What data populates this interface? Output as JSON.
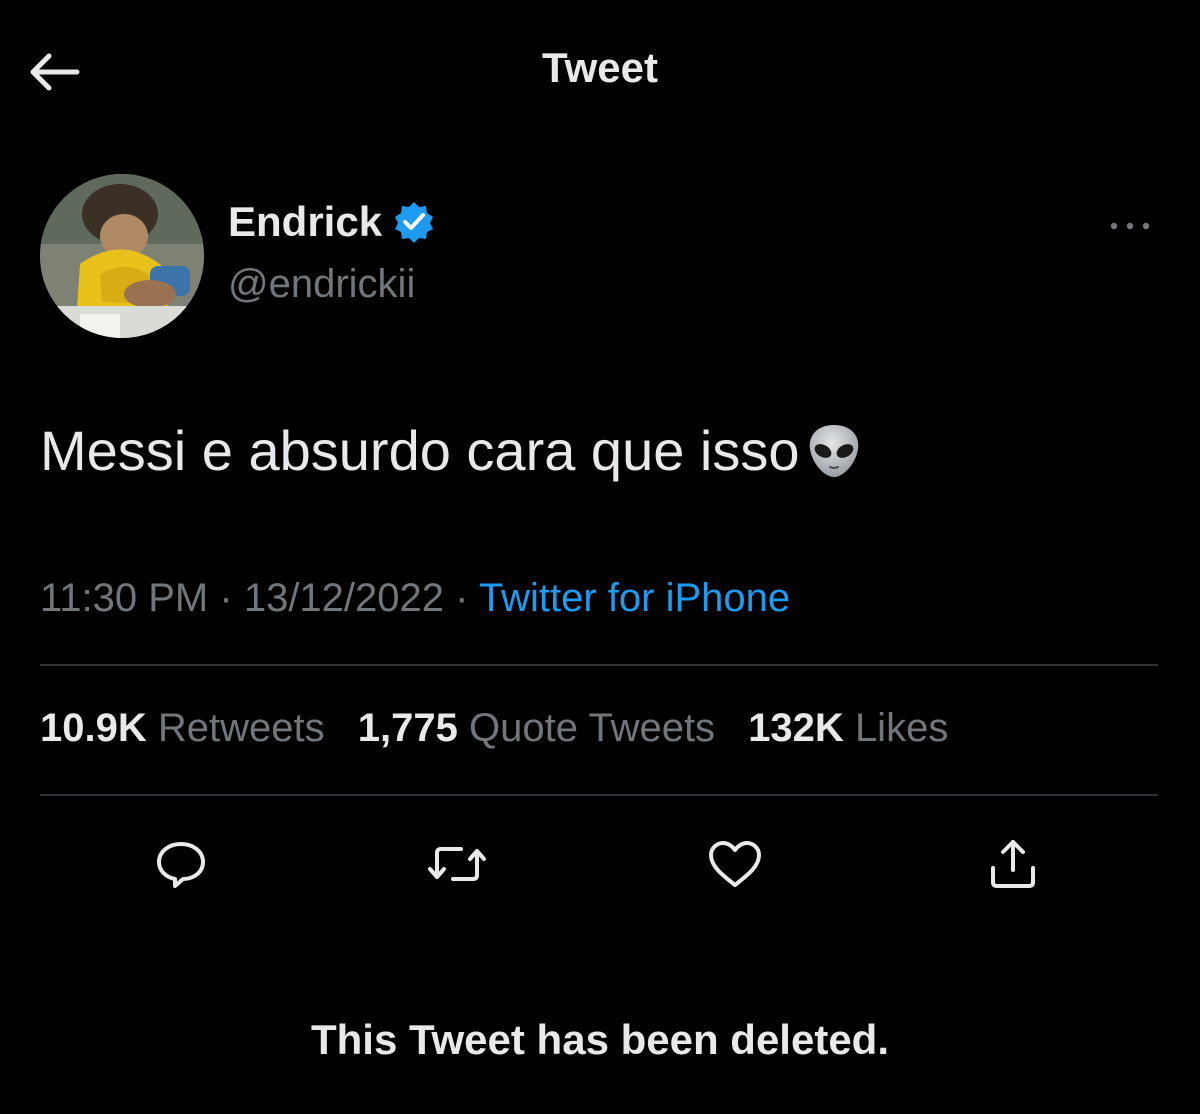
{
  "header": {
    "title": "Tweet",
    "back_icon": "arrow-left-icon"
  },
  "tweet": {
    "author": {
      "display_name": "Endrick",
      "handle": "@endrickii",
      "verified": true,
      "verified_color": "#1d9bf0"
    },
    "text": "Messi e absurdo cara que isso",
    "emoji": "alien-emoji",
    "time": "11:30 PM",
    "separator": "·",
    "date": "13/12/2022",
    "source": "Twitter for iPhone",
    "stats": [
      {
        "count": "10.9K",
        "label": "Retweets"
      },
      {
        "count": "1,775",
        "label": "Quote Tweets"
      },
      {
        "count": "132K",
        "label": "Likes"
      }
    ],
    "actions": [
      "reply-icon",
      "retweet-icon",
      "like-icon",
      "share-icon"
    ]
  },
  "notice": "This Tweet has been deleted.",
  "colors": {
    "background": "#000000",
    "text_primary": "#e7e9ea",
    "text_secondary": "#71767b",
    "accent": "#1d9bf0",
    "divider": "#2f3336"
  }
}
